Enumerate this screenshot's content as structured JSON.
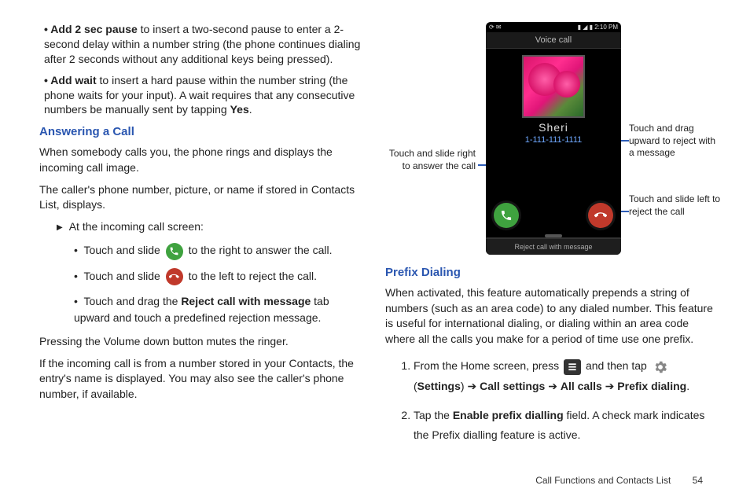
{
  "left": {
    "bullets": [
      {
        "bold": "Add 2 sec pause",
        "rest": " to insert a two-second pause to enter a 2-second delay within a number string (the phone continues dialing after 2 seconds without any additional keys being pressed)."
      },
      {
        "bold": "Add wait",
        "rest": " to insert a hard pause within the number string (the phone waits for your input). A wait requires that any consecutive numbers be manually sent by tapping ",
        "bold2": "Yes",
        "rest2": "."
      }
    ],
    "h_answer": "Answering a Call",
    "p1": "When somebody calls you, the phone rings and displays the incoming call image.",
    "p2": "The caller's phone number, picture, or name if stored in Contacts List, displays.",
    "tri": "At the incoming call screen:",
    "inner": {
      "touchslide": "Touch and slide",
      "right": " to the right to answer the call.",
      "left": " to the left to reject the call.",
      "drag1": "Touch and drag the ",
      "drag_bold": "Reject call with message",
      "drag2": " tab upward and touch a predefined rejection message."
    },
    "p3": "Pressing the Volume down button mutes the ringer.",
    "p4": "If the incoming call is from a number stored in your Contacts, the entry's name is displayed. You may also see the caller's phone number, if available."
  },
  "right": {
    "callouts": {
      "left1": "Touch and slide right to answer the call",
      "right1": "Touch and drag upward to reject with a message",
      "right2": "Touch and slide left to reject the call"
    },
    "phone": {
      "statusbar_left": "⟳ ✉",
      "statusbar_right": "▮ ◢ ▮ 2:10 PM",
      "title": "Voice call",
      "name": "Sheri",
      "number": "1-111-111-1111",
      "reject_tab": "Reject call with message"
    },
    "h_prefix": "Prefix Dialing",
    "p1": "When activated, this feature automatically prepends a string of numbers (such as an area code) to any dialed number. This feature is useful for international dialing, or dialing within an area code where all the calls you make for a period of time use one prefix.",
    "ol1_a": "From the Home screen, press ",
    "ol1_b": " and then tap ",
    "ol1_c_open": "(",
    "ol1_settings": "Settings",
    "ol1_arrow": ") ➔ ",
    "ol1_callsettings": "Call settings",
    "ol1_arrow2": " ➔ ",
    "ol1_allcalls": "All calls",
    "ol1_arrow3": " ➔ ",
    "ol1_prefix": "Prefix dialing",
    "ol1_dot": ".",
    "ol2_a": "Tap the ",
    "ol2_bold": "Enable prefix dialling",
    "ol2_b": " field. A check mark indicates the Prefix dialling feature is active."
  },
  "footer": {
    "chapter": "Call Functions and Contacts List",
    "page": "54"
  }
}
